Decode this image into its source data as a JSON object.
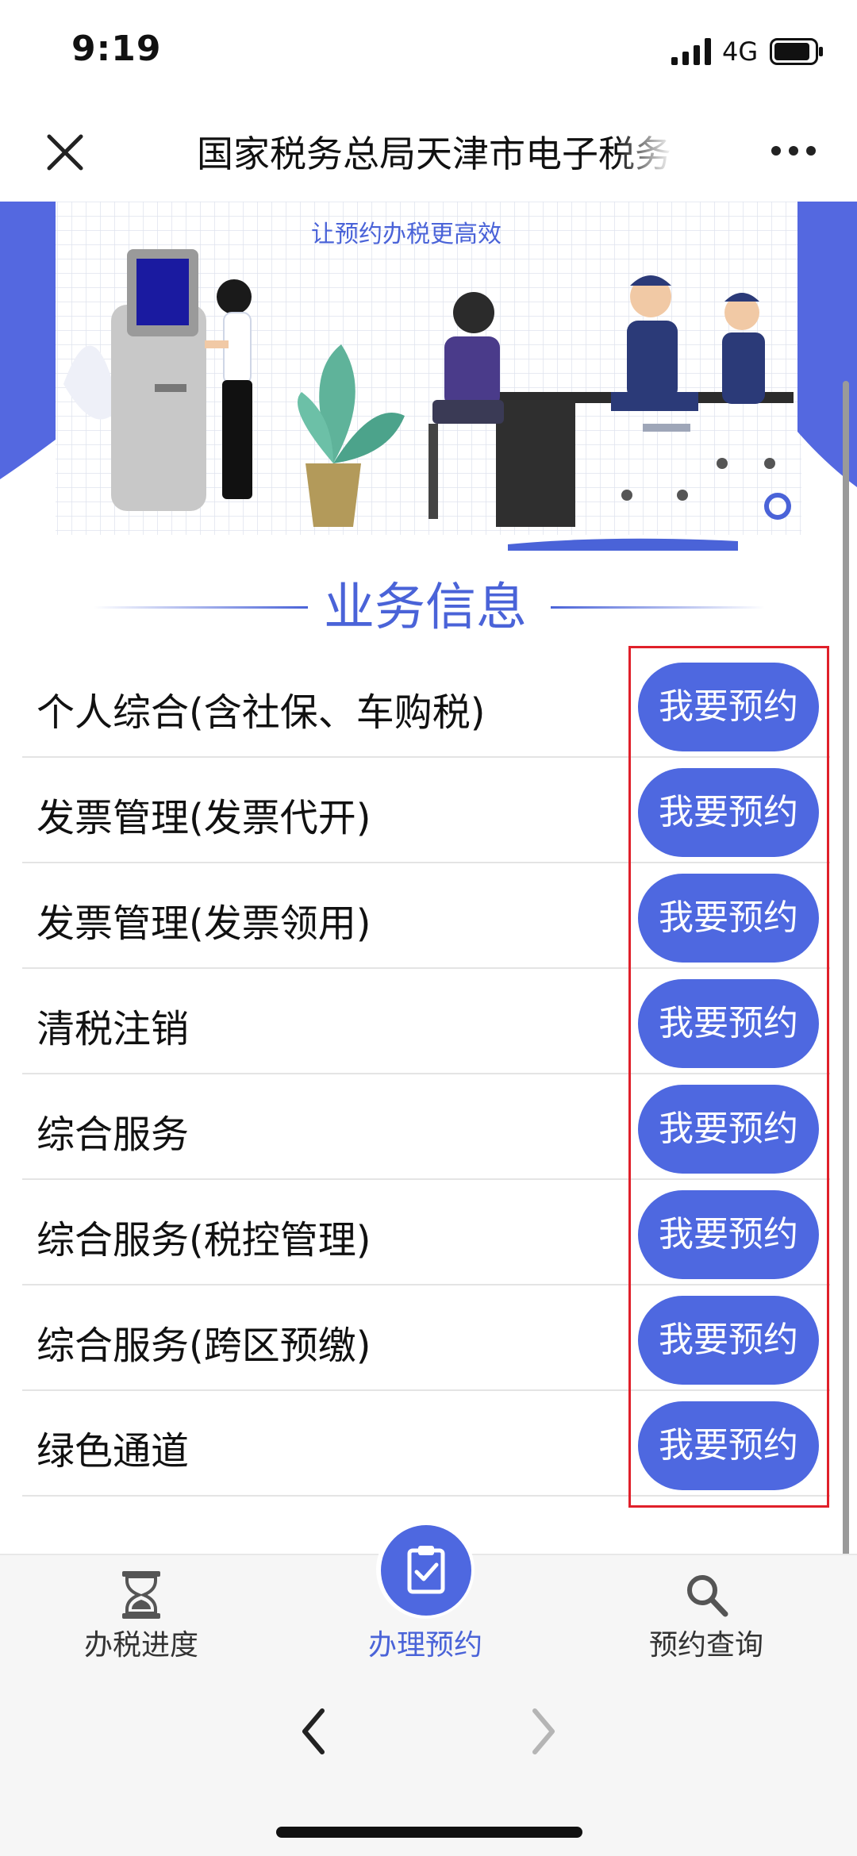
{
  "status_bar": {
    "time": "9:19",
    "network": "4G"
  },
  "title_bar": {
    "title": "国家税务总局天津市电子税务局"
  },
  "banner": {
    "caption": "让预约办税更高效"
  },
  "section": {
    "title": "业务信息"
  },
  "services": [
    {
      "label": "个人综合(含社保、车购税)",
      "button": "我要预约"
    },
    {
      "label": "发票管理(发票代开)",
      "button": "我要预约"
    },
    {
      "label": "发票管理(发票领用)",
      "button": "我要预约"
    },
    {
      "label": "清税注销",
      "button": "我要预约"
    },
    {
      "label": "综合服务",
      "button": "我要预约"
    },
    {
      "label": "综合服务(税控管理)",
      "button": "我要预约"
    },
    {
      "label": "综合服务(跨区预缴)",
      "button": "我要预约"
    },
    {
      "label": "绿色通道",
      "button": "我要预约"
    }
  ],
  "tabs": [
    {
      "label": "办税进度",
      "icon": "hourglass-icon",
      "active": false
    },
    {
      "label": "办理预约",
      "icon": "clipboard-check-icon",
      "active": true
    },
    {
      "label": "预约查询",
      "icon": "search-icon",
      "active": false
    }
  ],
  "colors": {
    "accent": "#4e68e0",
    "highlight_border": "#e0202a"
  }
}
